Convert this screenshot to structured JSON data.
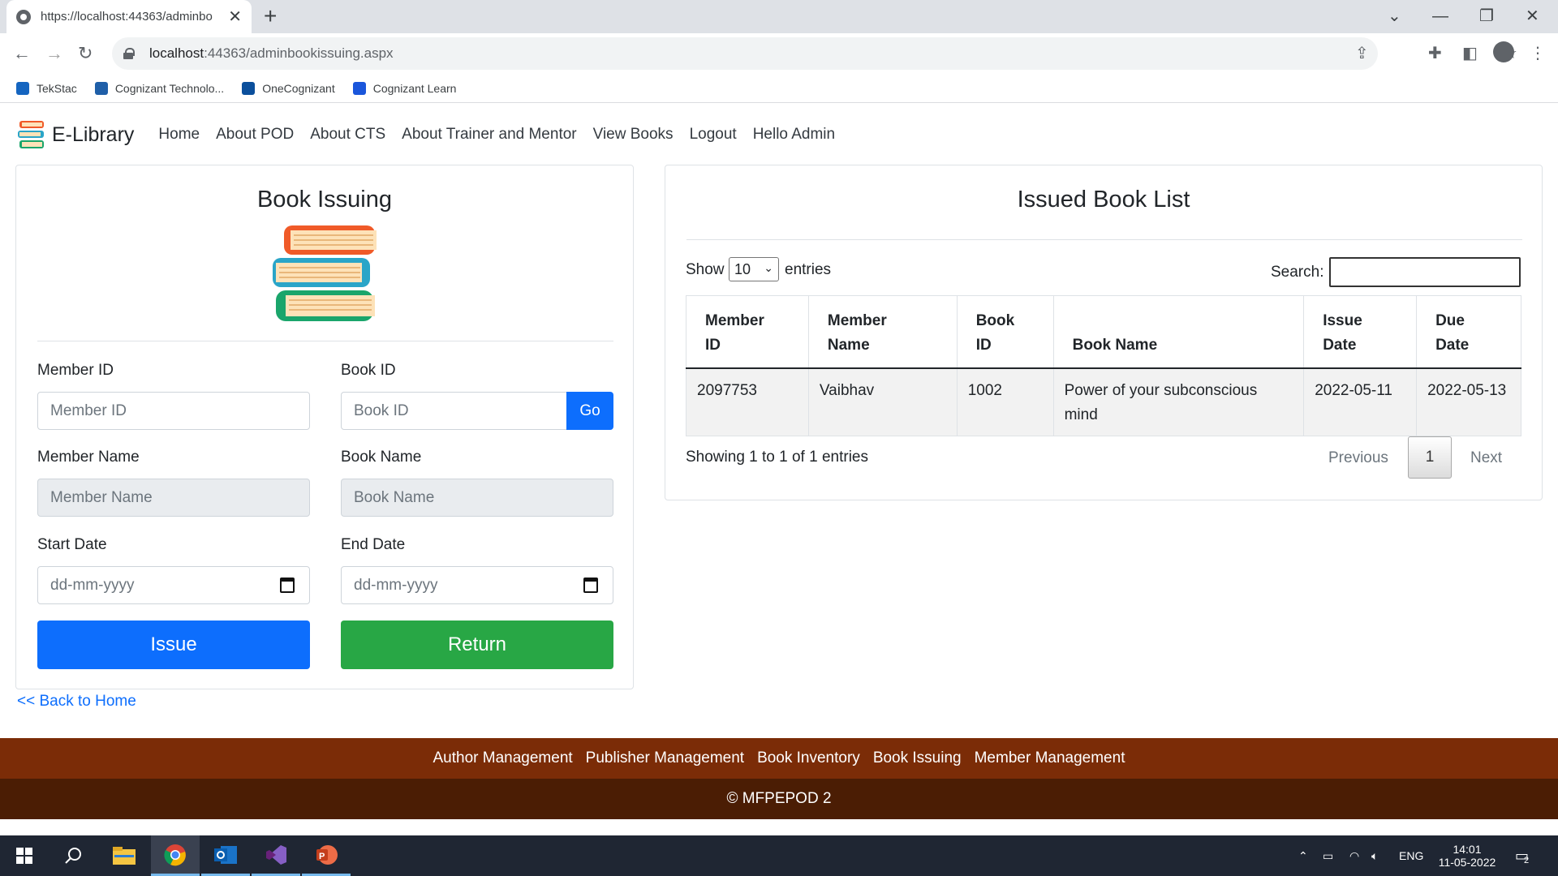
{
  "browser": {
    "tab_title": "https://localhost:44363/adminbo",
    "tab_close": "✕",
    "new_tab": "+",
    "url_host": "localhost",
    "url_rest": ":44363/adminbookissuing.aspx",
    "bookmarks": [
      {
        "label": "TekStac",
        "color": "#1565c0"
      },
      {
        "label": "Cognizant Technolo...",
        "color": "#1f5fa8"
      },
      {
        "label": "OneCognizant",
        "color": "#0b4f9c"
      },
      {
        "label": "Cognizant Learn",
        "color": "#1a56db"
      }
    ]
  },
  "navbar": {
    "brand": "E-Library",
    "links": [
      "Home",
      "About POD",
      "About CTS",
      "About Trainer and Mentor",
      "View Books",
      "Logout",
      "Hello Admin"
    ]
  },
  "issue_form": {
    "title": "Book Issuing",
    "member_id_label": "Member ID",
    "member_id_placeholder": "Member ID",
    "book_id_label": "Book ID",
    "book_id_placeholder": "Book ID",
    "go_label": "Go",
    "member_name_label": "Member Name",
    "member_name_placeholder": "Member Name",
    "book_name_label": "Book Name",
    "book_name_placeholder": "Book Name",
    "start_date_label": "Start Date",
    "start_date_value": "dd-mm-yyyy",
    "end_date_label": "End Date",
    "end_date_value": "dd-mm-yyyy",
    "issue_label": "Issue",
    "return_label": "Return",
    "back_link": "<< Back to Home"
  },
  "issued_list": {
    "title": "Issued Book List",
    "show_label": "Show",
    "entries_label": "entries",
    "page_size": "10",
    "search_label": "Search:",
    "columns": [
      [
        "Member",
        "ID"
      ],
      [
        "Member",
        "Name"
      ],
      [
        "Book",
        "ID"
      ],
      [
        "",
        "Book Name"
      ],
      [
        "Issue",
        "Date"
      ],
      [
        "Due",
        "Date"
      ]
    ],
    "rows": [
      [
        "2097753",
        "Vaibhav",
        "1002",
        "Power of your subconscious mind",
        "2022-05-11",
        "2022-05-13"
      ]
    ],
    "info": "Showing 1 to 1 of 1 entries",
    "previous": "Previous",
    "current_page": "1",
    "next": "Next"
  },
  "footer": {
    "links": [
      "Author Management",
      "Publisher Management",
      "Book Inventory",
      "Book Issuing",
      "Member Management"
    ],
    "copyright": "© MFPEPOD 2"
  },
  "taskbar": {
    "lang": "ENG",
    "time": "14:01",
    "date": "11-05-2022",
    "notifications": "2"
  },
  "colors": {
    "primary": "#0d6efd",
    "success": "#28a745",
    "footer_top": "#7b2c07",
    "footer_bottom": "#4b1d04"
  }
}
